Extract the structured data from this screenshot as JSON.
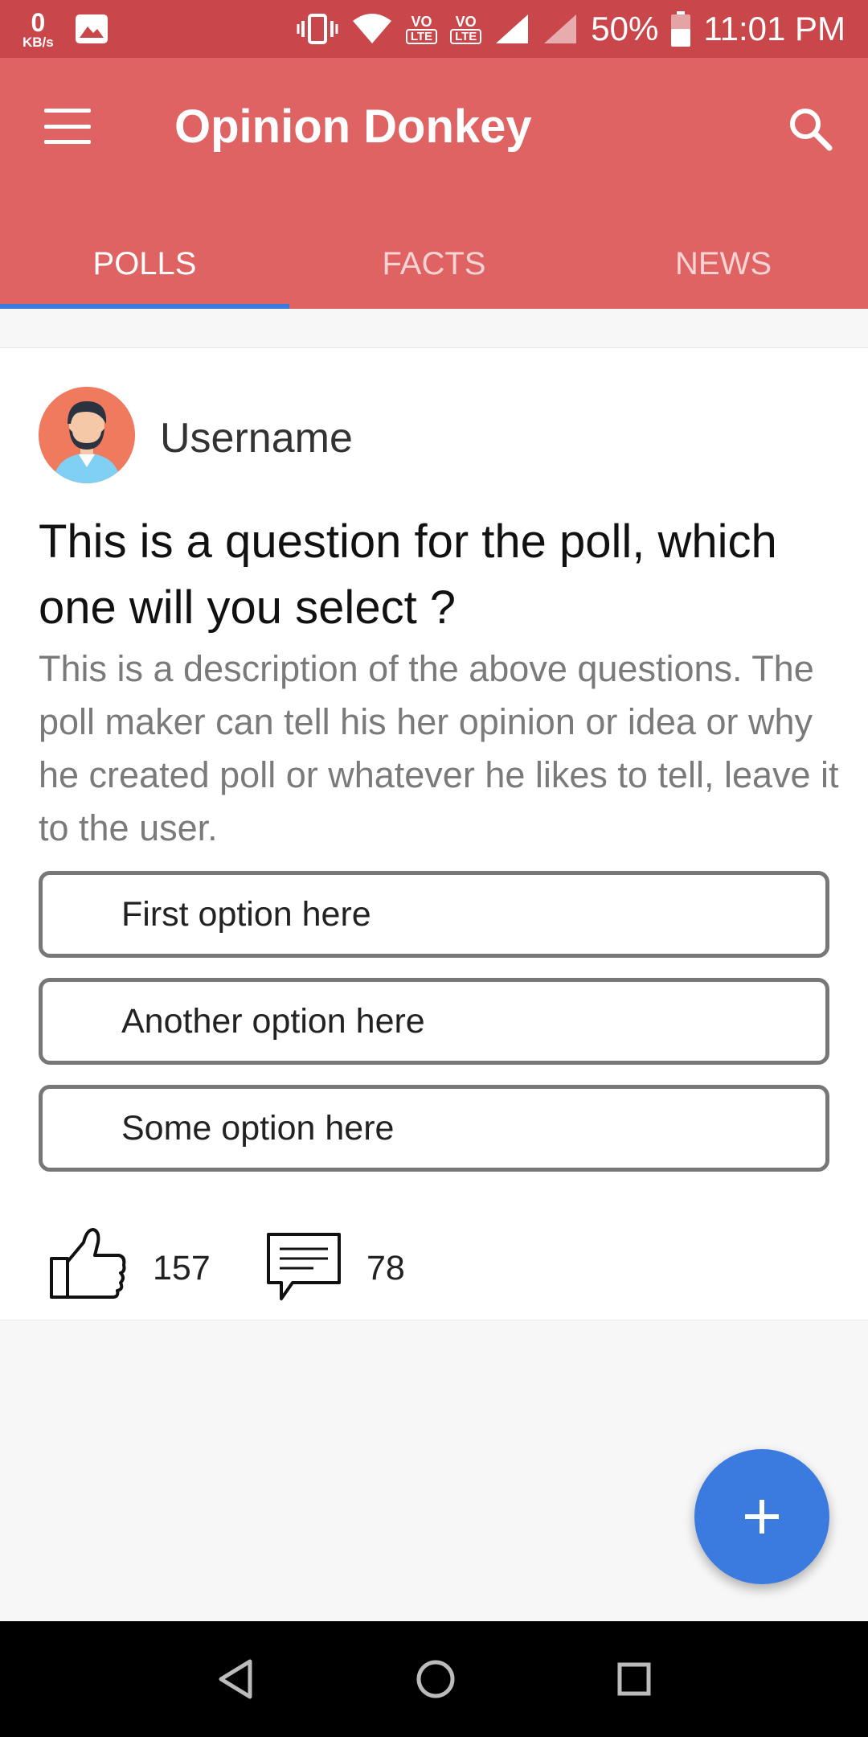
{
  "status_bar": {
    "net_speed_value": "0",
    "net_speed_unit": "KB/s",
    "sim1_label": "VO",
    "sim1_badge": "LTE",
    "sim2_label": "VO",
    "sim2_badge": "LTE",
    "battery": "50%",
    "time": "11:01 PM"
  },
  "app_bar": {
    "title": "Opinion Donkey",
    "menu_icon": "hamburger-menu-icon",
    "search_icon": "search-icon",
    "color": "#e06363"
  },
  "tabs": [
    {
      "label": "POLLS",
      "active": true
    },
    {
      "label": "FACTS",
      "active": false
    },
    {
      "label": "NEWS",
      "active": false
    }
  ],
  "poll": {
    "username": "Username",
    "question": "This is a question for the poll, which one will you select ?",
    "description": "This is a description of the above questions. The poll maker can tell his her opinion or idea or why he created poll or whatever he likes to tell, leave it to the user.",
    "options": [
      "First option here",
      "Another option here",
      "Some option here"
    ],
    "likes": "157",
    "comments": "78"
  },
  "fab": {
    "icon": "plus-icon",
    "color": "#3b7be0"
  },
  "nav_bar": {
    "icons": [
      "back-icon",
      "home-icon",
      "recents-icon"
    ]
  }
}
